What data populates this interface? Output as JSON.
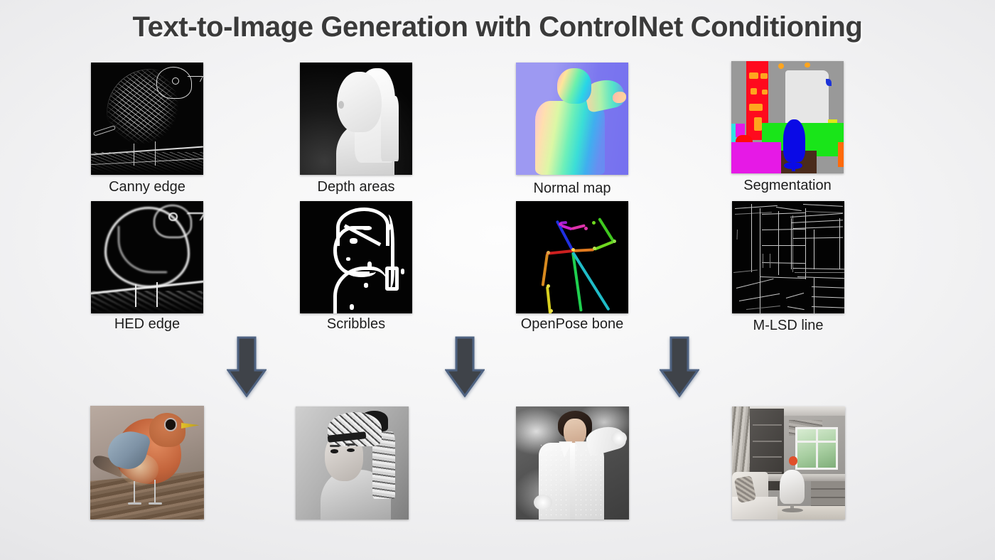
{
  "title": "Text-to-Image Generation with ControlNet Conditioning",
  "conditions": {
    "row1": [
      {
        "label": "Canny edge",
        "kind": "canny"
      },
      {
        "label": "Depth areas",
        "kind": "depth"
      },
      {
        "label": "Normal map",
        "kind": "normal"
      },
      {
        "label": "Segmentation",
        "kind": "segmentation"
      }
    ],
    "row2": [
      {
        "label": "HED edge",
        "kind": "hed"
      },
      {
        "label": "Scribbles",
        "kind": "scribbles"
      },
      {
        "label": "OpenPose bone",
        "kind": "openpose"
      },
      {
        "label": "M-LSD line",
        "kind": "mlsd"
      }
    ]
  },
  "arrows": [
    {
      "name": "arrow-down-column-1",
      "glyph": "down-arrow"
    },
    {
      "name": "arrow-down-column-2",
      "glyph": "down-arrow"
    },
    {
      "name": "arrow-down-column-3",
      "glyph": "down-arrow"
    }
  ],
  "outputs": [
    {
      "name": "generated-bird",
      "alt": "Generated orange robin-like bird perched on a wooden branch"
    },
    {
      "name": "generated-portrait",
      "alt": "Black and white portrait of a woman with a patterned head wrap"
    },
    {
      "name": "generated-woman-blouse",
      "alt": "Woman in a white blouse with arm raised against a cloudy gray backdrop"
    },
    {
      "name": "generated-room",
      "alt": "Modern gray home office interior with white desk chair and window"
    }
  ],
  "colors": {
    "title_text": "#3a3a3a",
    "caption_text": "#1d1d1d",
    "arrow_fill": "#3f4349",
    "arrow_border": "#4f6382",
    "background_light": "#fdfdfd",
    "background_dark": "#d2d2d6",
    "normal_map_background": "#8a86f0",
    "segmentation_wall": "#999999",
    "segmentation_shelf": "#ff0a1e",
    "segmentation_sofa": "#19e519",
    "segmentation_chair": "#0a0ae6",
    "segmentation_bed": "#e619e6"
  }
}
